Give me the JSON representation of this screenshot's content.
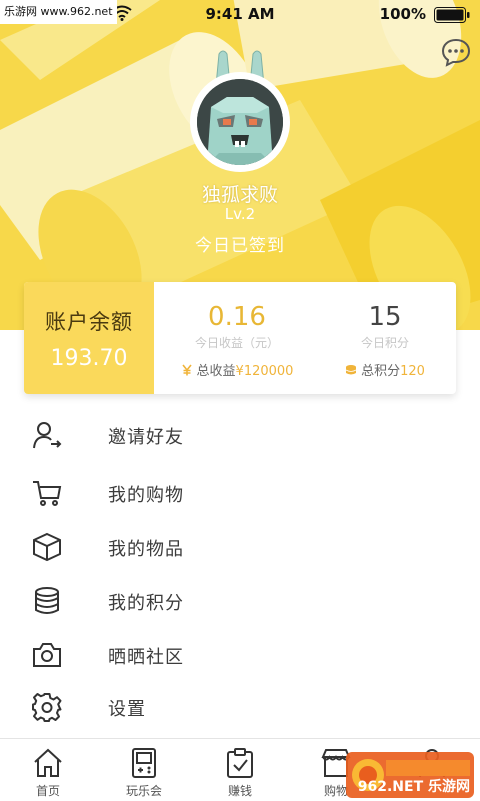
{
  "watermark_top": "乐游网 www.962.net",
  "status_bar": {
    "time": "9:41 AM",
    "battery": "100%"
  },
  "profile": {
    "name": "独孤求败",
    "level": "Lv.2",
    "signin_status": "今日已签到"
  },
  "stats": {
    "balance_title": "账户余额",
    "balance_value": "193.70",
    "today_earnings_value": "0.16",
    "today_earnings_label": "今日收益（元）",
    "total_earnings_label": "总收益",
    "total_earnings_value": "¥120000",
    "today_points_value": "15",
    "today_points_label": "今日积分",
    "total_points_label": "总积分",
    "total_points_value": "120"
  },
  "menu": [
    {
      "label": "邀请好友",
      "icon": "invite-user-icon"
    },
    {
      "label": "我的购物",
      "icon": "shopping-cart-icon"
    },
    {
      "label": "我的物品",
      "icon": "box-icon"
    },
    {
      "label": "我的积分",
      "icon": "database-coins-icon"
    },
    {
      "label": "晒晒社区",
      "icon": "camera-icon"
    },
    {
      "label": "设置",
      "icon": "gear-icon"
    }
  ],
  "tabs": [
    {
      "label": "首页",
      "icon": "home-icon"
    },
    {
      "label": "玩乐会",
      "icon": "game-console-icon"
    },
    {
      "label": "赚钱",
      "icon": "clipboard-check-icon"
    },
    {
      "label": "购物",
      "icon": "store-icon"
    },
    {
      "label": "",
      "icon": "profile-icon"
    }
  ],
  "watermark_bottom": "962.NET 乐游网",
  "colors": {
    "accent": "#f7d84a",
    "accent_text": "#e8b735",
    "coin": "#f0b43a"
  }
}
